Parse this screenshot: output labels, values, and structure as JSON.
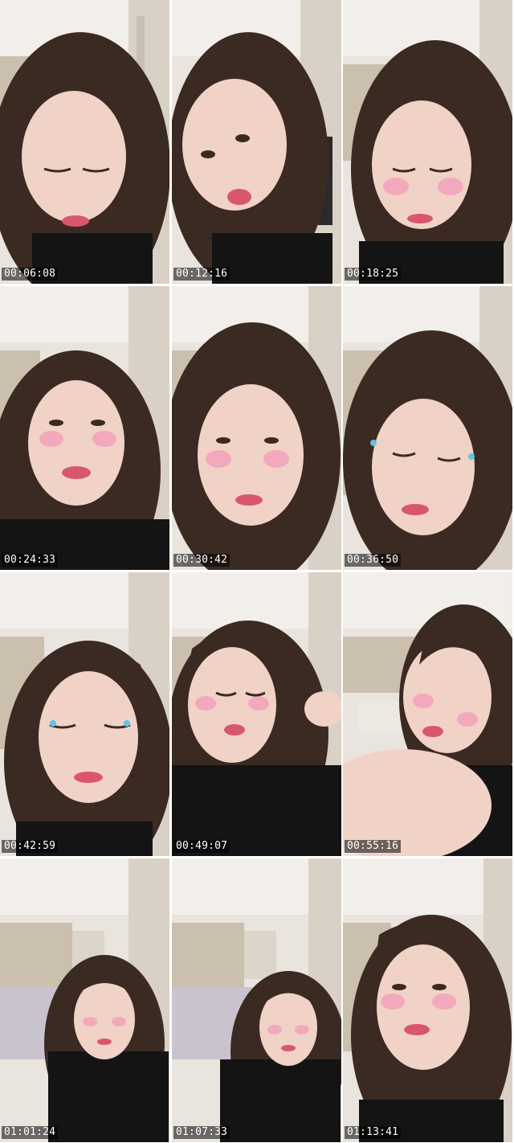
{
  "contact_sheet": {
    "frames": [
      {
        "timestamp": "00:06:08",
        "variant": 0
      },
      {
        "timestamp": "00:12:16",
        "variant": 1
      },
      {
        "timestamp": "00:18:25",
        "variant": 2
      },
      {
        "timestamp": "00:24:33",
        "variant": 3
      },
      {
        "timestamp": "00:30:42",
        "variant": 2
      },
      {
        "timestamp": "00:36:50",
        "variant": 4
      },
      {
        "timestamp": "00:42:59",
        "variant": 4
      },
      {
        "timestamp": "00:49:07",
        "variant": 5
      },
      {
        "timestamp": "00:55:16",
        "variant": 6
      },
      {
        "timestamp": "01:01:24",
        "variant": 7
      },
      {
        "timestamp": "01:07:33",
        "variant": 7
      },
      {
        "timestamp": "01:13:41",
        "variant": 2
      }
    ]
  },
  "colors": {
    "wall": "#e9e4dd",
    "ceiling": "#f2efea",
    "cabinet": "#d8cfc2",
    "hair": "#3a2a22",
    "skin": "#f1d2c6",
    "top": "#141414",
    "blush": "#f3a9bd",
    "timestamp_bg": "#000000",
    "timestamp_text": "#ffffff"
  }
}
